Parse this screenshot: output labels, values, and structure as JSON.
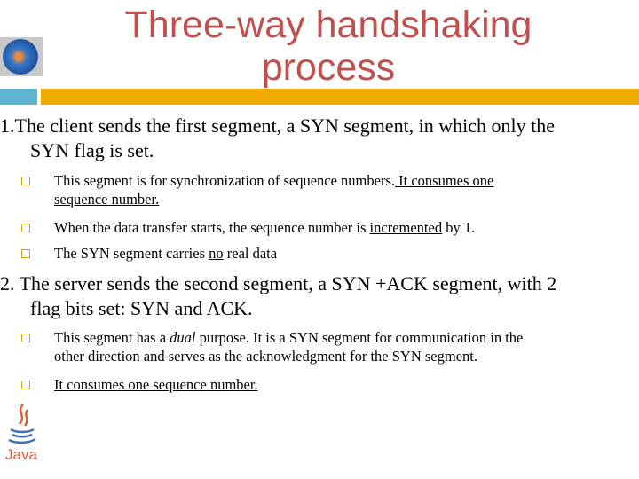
{
  "slide": {
    "title_line1": "Three-way handshaking",
    "title_line2": "process",
    "colors": {
      "title": "#c0504d",
      "accent_blue": "#5fb4d0",
      "accent_orange": "#efab00",
      "bullet_border": "#d4a017"
    },
    "logo_icon": "globe-logo-icon",
    "java_icon": "java-logo-icon",
    "java_label": "Java",
    "point1": {
      "line1": "1.The client sends the first segment, a SYN segment, in which only the",
      "line2": "SYN flag is set.",
      "bullets": [
        {
          "text_a": "This segment is for synchronization of sequence numbers.",
          "text_u": " It consumes one",
          "text_u2": "sequence number."
        },
        {
          "text_a": "When the data transfer starts, the sequence number is ",
          "text_u": "incremented",
          "text_b": " by 1."
        },
        {
          "text_a": "The SYN segment carries ",
          "text_u": "no",
          "text_b": " real data"
        }
      ]
    },
    "point2": {
      "line1": "2. The server sends the second segment, a SYN +ACK segment, with 2",
      "line2": "flag bits set: SYN and ACK.",
      "bullets": [
        {
          "text_a": "This segment has a ",
          "text_i": "dual",
          "text_b": " purpose. It is a SYN segment for communication in the",
          "line2": "other direction and serves as the acknowledgment for the SYN segment."
        },
        {
          "text_u": "It consumes one sequence number."
        }
      ]
    }
  }
}
